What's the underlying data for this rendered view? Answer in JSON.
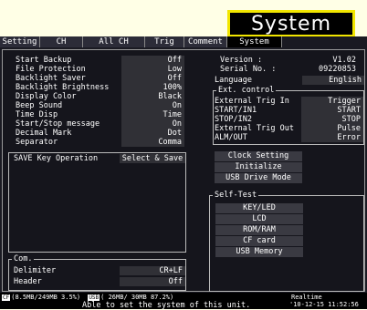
{
  "banner": "System",
  "tabs": [
    "Setting",
    "CH",
    "All CH",
    "Trig",
    "Comment",
    "System"
  ],
  "left_settings": [
    {
      "label": "Start Backup",
      "value": "Off"
    },
    {
      "label": "File Protection",
      "value": "Low"
    },
    {
      "label": "Backlight Saver",
      "value": "Off"
    },
    {
      "label": "Backlight Brightness",
      "value": "100%"
    },
    {
      "label": "Display Color",
      "value": "Black"
    },
    {
      "label": "Beep Sound",
      "value": "On"
    },
    {
      "label": "Time Disp",
      "value": "Time"
    },
    {
      "label": "Start/Stop message",
      "value": "On"
    },
    {
      "label": "Decimal Mark",
      "value": "Dot"
    },
    {
      "label": "Separator",
      "value": "Comma"
    }
  ],
  "version": {
    "label": "Version :",
    "value": "V1.02"
  },
  "serial": {
    "label": "Serial No. :",
    "value": "09220853"
  },
  "language": {
    "label": "Language",
    "value": "English"
  },
  "ext_control": {
    "title": "Ext. control",
    "items": [
      {
        "label": "External Trig In",
        "value": "Trigger"
      },
      {
        "label": "START/IN1",
        "value": "START"
      },
      {
        "label": "STOP/IN2",
        "value": "STOP"
      },
      {
        "label": "External Trig Out",
        "value": "Pulse"
      },
      {
        "label": "ALM/OUT",
        "value": "Error"
      }
    ]
  },
  "save_key": {
    "label": "SAVE Key Operation",
    "value": "Select & Save"
  },
  "actions": [
    "Clock Setting",
    "Initialize",
    "USB Drive Mode"
  ],
  "self_test": {
    "title": "Self-Test",
    "items": [
      "KEY/LED",
      "LCD",
      "ROM/RAM",
      "CF card",
      "USB Memory"
    ]
  },
  "com": {
    "title": "Com.",
    "items": [
      {
        "label": "Delimiter",
        "value": "CR+LF"
      },
      {
        "label": "Header",
        "value": "Off"
      }
    ]
  },
  "status": {
    "cf_chip": "CF",
    "cf_usage": "(8.5MB/249MB  3.5%)",
    "usb_chip": "USB",
    "usb_usage": "( 26MB/ 30MB 87.2%)",
    "message": "Able to set the system of this unit.",
    "realtime_label": "Realtime",
    "clock": "'10-12-15 11:52:56"
  }
}
